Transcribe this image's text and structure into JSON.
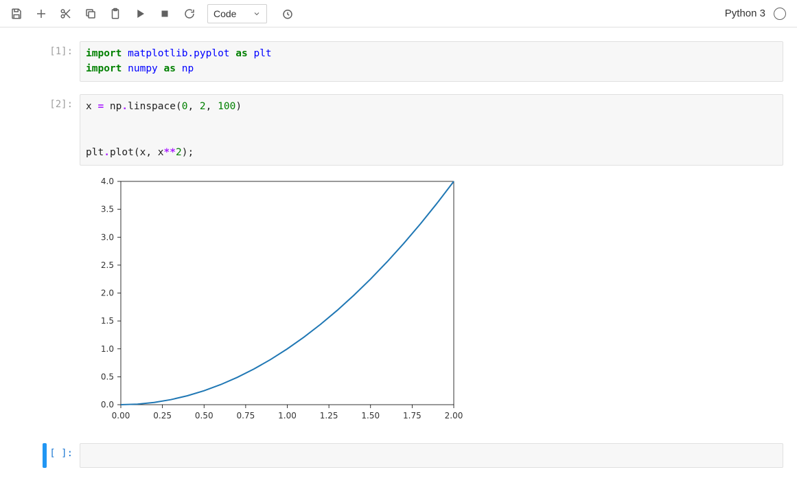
{
  "toolbar": {
    "celltype_label": "Code"
  },
  "kernel": {
    "name": "Python 3"
  },
  "cells": {
    "c1": {
      "prompt": "[1]:",
      "tokens": [
        [
          "k-imp",
          "import"
        ],
        [
          "",
          " "
        ],
        [
          "k-mod",
          "matplotlib.pyplot"
        ],
        [
          "",
          " "
        ],
        [
          "k-as",
          "as"
        ],
        [
          "",
          " "
        ],
        [
          "k-mod",
          "plt"
        ],
        [
          "",
          "\n"
        ],
        [
          "k-imp",
          "import"
        ],
        [
          "",
          " "
        ],
        [
          "k-mod",
          "numpy"
        ],
        [
          "",
          " "
        ],
        [
          "k-as",
          "as"
        ],
        [
          "",
          " "
        ],
        [
          "k-mod",
          "np"
        ]
      ]
    },
    "c2": {
      "prompt": "[2]:",
      "tokens": [
        [
          "",
          "x "
        ],
        [
          "k-op",
          "="
        ],
        [
          "",
          " np"
        ],
        [
          "k-op",
          "."
        ],
        [
          "",
          "linspace("
        ],
        [
          "k-num",
          "0"
        ],
        [
          "",
          ", "
        ],
        [
          "k-num",
          "2"
        ],
        [
          "",
          ", "
        ],
        [
          "k-num",
          "100"
        ],
        [
          "",
          ")\n\n\nplt"
        ],
        [
          "k-op",
          "."
        ],
        [
          "",
          "plot(x, x"
        ],
        [
          "k-op",
          "**"
        ],
        [
          "k-num",
          "2"
        ],
        [
          "",
          ");"
        ]
      ]
    },
    "c3": {
      "prompt": "[ ]:",
      "tokens": [
        [
          "",
          ""
        ]
      ]
    }
  },
  "chart_data": {
    "type": "line",
    "title": "",
    "xlabel": "",
    "ylabel": "",
    "xlim": [
      0,
      2
    ],
    "ylim": [
      0,
      4
    ],
    "xticks": [
      0.0,
      0.25,
      0.5,
      0.75,
      1.0,
      1.25,
      1.5,
      1.75,
      2.0
    ],
    "yticks": [
      0.0,
      0.5,
      1.0,
      1.5,
      2.0,
      2.5,
      3.0,
      3.5,
      4.0
    ],
    "xtick_labels": [
      "0.00",
      "0.25",
      "0.50",
      "0.75",
      "1.00",
      "1.25",
      "1.50",
      "1.75",
      "2.00"
    ],
    "ytick_labels": [
      "0.0",
      "0.5",
      "1.0",
      "1.5",
      "2.0",
      "2.5",
      "3.0",
      "3.5",
      "4.0"
    ],
    "series": [
      {
        "name": "x**2",
        "color": "#1f77b4",
        "x": [
          0.0,
          0.1,
          0.2,
          0.3,
          0.4,
          0.5,
          0.6,
          0.7,
          0.8,
          0.9,
          1.0,
          1.1,
          1.2,
          1.3,
          1.4,
          1.5,
          1.6,
          1.7,
          1.8,
          1.9,
          2.0
        ],
        "y": [
          0.0,
          0.01,
          0.04,
          0.09,
          0.16,
          0.25,
          0.36,
          0.49,
          0.64,
          0.81,
          1.0,
          1.21,
          1.44,
          1.69,
          1.96,
          2.25,
          2.56,
          2.89,
          3.24,
          3.61,
          4.0
        ]
      }
    ]
  }
}
